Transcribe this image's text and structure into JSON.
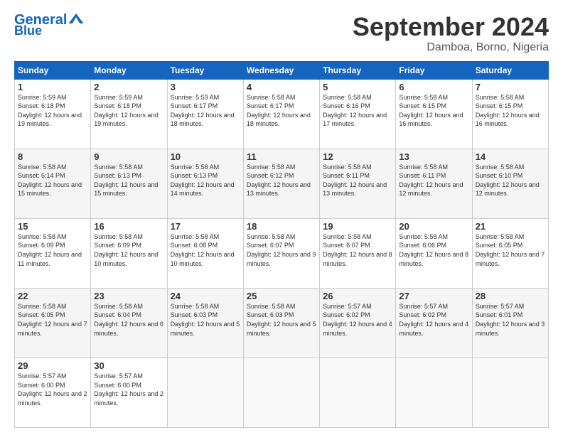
{
  "header": {
    "logo_line1": "General",
    "logo_line2": "Blue",
    "title": "September 2024",
    "subtitle": "Damboa, Borno, Nigeria"
  },
  "calendar": {
    "days_of_week": [
      "Sunday",
      "Monday",
      "Tuesday",
      "Wednesday",
      "Thursday",
      "Friday",
      "Saturday"
    ],
    "weeks": [
      [
        {
          "day": "1",
          "info": "Sunrise: 5:59 AM\nSunset: 6:18 PM\nDaylight: 12 hours and 19 minutes."
        },
        {
          "day": "2",
          "info": "Sunrise: 5:59 AM\nSunset: 6:18 PM\nDaylight: 12 hours and 19 minutes."
        },
        {
          "day": "3",
          "info": "Sunrise: 5:59 AM\nSunset: 6:17 PM\nDaylight: 12 hours and 18 minutes."
        },
        {
          "day": "4",
          "info": "Sunrise: 5:58 AM\nSunset: 6:17 PM\nDaylight: 12 hours and 18 minutes."
        },
        {
          "day": "5",
          "info": "Sunrise: 5:58 AM\nSunset: 6:16 PM\nDaylight: 12 hours and 17 minutes."
        },
        {
          "day": "6",
          "info": "Sunrise: 5:58 AM\nSunset: 6:15 PM\nDaylight: 12 hours and 16 minutes."
        },
        {
          "day": "7",
          "info": "Sunrise: 5:58 AM\nSunset: 6:15 PM\nDaylight: 12 hours and 16 minutes."
        }
      ],
      [
        {
          "day": "8",
          "info": "Sunrise: 5:58 AM\nSunset: 6:14 PM\nDaylight: 12 hours and 15 minutes."
        },
        {
          "day": "9",
          "info": "Sunrise: 5:58 AM\nSunset: 6:13 PM\nDaylight: 12 hours and 15 minutes."
        },
        {
          "day": "10",
          "info": "Sunrise: 5:58 AM\nSunset: 6:13 PM\nDaylight: 12 hours and 14 minutes."
        },
        {
          "day": "11",
          "info": "Sunrise: 5:58 AM\nSunset: 6:12 PM\nDaylight: 12 hours and 13 minutes."
        },
        {
          "day": "12",
          "info": "Sunrise: 5:58 AM\nSunset: 6:11 PM\nDaylight: 12 hours and 13 minutes."
        },
        {
          "day": "13",
          "info": "Sunrise: 5:58 AM\nSunset: 6:11 PM\nDaylight: 12 hours and 12 minutes."
        },
        {
          "day": "14",
          "info": "Sunrise: 5:58 AM\nSunset: 6:10 PM\nDaylight: 12 hours and 12 minutes."
        }
      ],
      [
        {
          "day": "15",
          "info": "Sunrise: 5:58 AM\nSunset: 6:09 PM\nDaylight: 12 hours and 11 minutes."
        },
        {
          "day": "16",
          "info": "Sunrise: 5:58 AM\nSunset: 6:09 PM\nDaylight: 12 hours and 10 minutes."
        },
        {
          "day": "17",
          "info": "Sunrise: 5:58 AM\nSunset: 6:08 PM\nDaylight: 12 hours and 10 minutes."
        },
        {
          "day": "18",
          "info": "Sunrise: 5:58 AM\nSunset: 6:07 PM\nDaylight: 12 hours and 9 minutes."
        },
        {
          "day": "19",
          "info": "Sunrise: 5:58 AM\nSunset: 6:07 PM\nDaylight: 12 hours and 8 minutes."
        },
        {
          "day": "20",
          "info": "Sunrise: 5:58 AM\nSunset: 6:06 PM\nDaylight: 12 hours and 8 minutes."
        },
        {
          "day": "21",
          "info": "Sunrise: 5:58 AM\nSunset: 6:05 PM\nDaylight: 12 hours and 7 minutes."
        }
      ],
      [
        {
          "day": "22",
          "info": "Sunrise: 5:58 AM\nSunset: 6:05 PM\nDaylight: 12 hours and 7 minutes."
        },
        {
          "day": "23",
          "info": "Sunrise: 5:58 AM\nSunset: 6:04 PM\nDaylight: 12 hours and 6 minutes."
        },
        {
          "day": "24",
          "info": "Sunrise: 5:58 AM\nSunset: 6:03 PM\nDaylight: 12 hours and 5 minutes."
        },
        {
          "day": "25",
          "info": "Sunrise: 5:58 AM\nSunset: 6:03 PM\nDaylight: 12 hours and 5 minutes."
        },
        {
          "day": "26",
          "info": "Sunrise: 5:57 AM\nSunset: 6:02 PM\nDaylight: 12 hours and 4 minutes."
        },
        {
          "day": "27",
          "info": "Sunrise: 5:57 AM\nSunset: 6:02 PM\nDaylight: 12 hours and 4 minutes."
        },
        {
          "day": "28",
          "info": "Sunrise: 5:57 AM\nSunset: 6:01 PM\nDaylight: 12 hours and 3 minutes."
        }
      ],
      [
        {
          "day": "29",
          "info": "Sunrise: 5:57 AM\nSunset: 6:00 PM\nDaylight: 12 hours and 2 minutes."
        },
        {
          "day": "30",
          "info": "Sunrise: 5:57 AM\nSunset: 6:00 PM\nDaylight: 12 hours and 2 minutes."
        },
        {
          "day": "",
          "info": ""
        },
        {
          "day": "",
          "info": ""
        },
        {
          "day": "",
          "info": ""
        },
        {
          "day": "",
          "info": ""
        },
        {
          "day": "",
          "info": ""
        }
      ]
    ]
  }
}
